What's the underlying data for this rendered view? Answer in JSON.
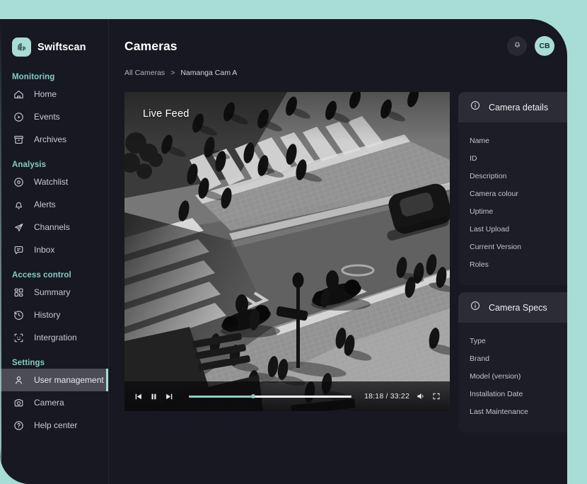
{
  "theme": {
    "background": "#A8DCD7",
    "app_bg": "#171821",
    "accent": "#A8DCD7",
    "section_label": "#7FCFC6",
    "panel_bg": "#1C1D26",
    "panel_head_bg": "#2B2C35"
  },
  "brand": {
    "name": "Swiftscan",
    "logo_icon": "fingerprint-icon"
  },
  "sidebar": {
    "sections": [
      {
        "label": "Monitoring",
        "items": [
          {
            "label": "Home",
            "icon": "home-icon",
            "active": false
          },
          {
            "label": "Events",
            "icon": "play-circle-icon",
            "active": false
          },
          {
            "label": "Archives",
            "icon": "archive-icon",
            "active": false
          }
        ]
      },
      {
        "label": "Analysis",
        "items": [
          {
            "label": "Watchlist",
            "icon": "eye-icon",
            "active": false
          },
          {
            "label": "Alerts",
            "icon": "bell-icon",
            "active": false
          },
          {
            "label": "Channels",
            "icon": "send-icon",
            "active": false
          },
          {
            "label": "Inbox",
            "icon": "chat-bubble-icon",
            "active": false
          }
        ]
      },
      {
        "label": "Access control",
        "items": [
          {
            "label": "Summary",
            "icon": "grid-icon",
            "active": false
          },
          {
            "label": "History",
            "icon": "clock-history-icon",
            "active": false
          },
          {
            "label": "Intergration",
            "icon": "face-scan-icon",
            "active": false
          }
        ]
      },
      {
        "label": "Settings",
        "items": [
          {
            "label": "User management",
            "icon": "user-icon",
            "active": true
          },
          {
            "label": "Camera",
            "icon": "camera-icon",
            "active": false
          },
          {
            "label": "Help center",
            "icon": "question-circle-icon",
            "active": false
          }
        ]
      }
    ]
  },
  "header": {
    "title": "Cameras",
    "notification_icon": "bell-icon",
    "avatar_initials": "CB"
  },
  "breadcrumb": {
    "root": "All Cameras",
    "separator": ">",
    "current": "Namanga Cam A"
  },
  "player": {
    "live_label": "Live Feed",
    "timecode": "18:18 / 33:22",
    "current_time": "18:18",
    "duration": "33:22",
    "progress_percent": 39.5,
    "controls": {
      "skip_back_icon": "skip-back-icon",
      "pause_icon": "pause-icon",
      "skip_forward_icon": "skip-forward-icon",
      "volume_icon": "volume-icon",
      "fullscreen_icon": "fullscreen-icon"
    }
  },
  "panels": [
    {
      "title": "Camera details",
      "icon": "info-icon",
      "fields": [
        "Name",
        "ID",
        "Description",
        "Camera colour",
        "Uptime",
        "Last Upload",
        "Current Version",
        "Roles"
      ]
    },
    {
      "title": "Camera Specs",
      "icon": "info-icon",
      "fields": [
        "Type",
        "Brand",
        "Model (version)",
        "Installation Date",
        "Last Maintenance"
      ]
    }
  ]
}
